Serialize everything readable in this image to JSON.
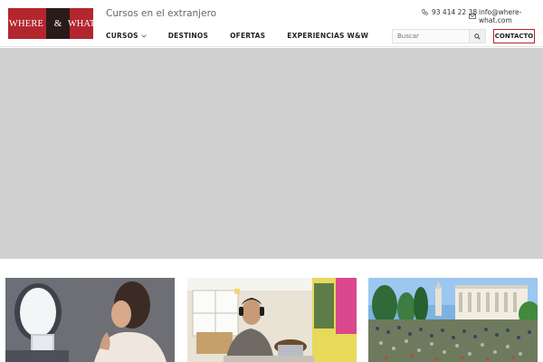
{
  "logo": {
    "left": "WHERE",
    "amp": "&",
    "right": "WHAT"
  },
  "header": {
    "tagline": "Cursos en el extranjero",
    "phone": "93 414 22 38",
    "email": "info@where-what.com"
  },
  "nav": {
    "items": [
      {
        "label": "CURSOS",
        "has_dropdown": true
      },
      {
        "label": "DESTINOS"
      },
      {
        "label": "OFERTAS"
      },
      {
        "label": "EXPERIENCIAS W&W"
      }
    ]
  },
  "search": {
    "placeholder": "Buscar"
  },
  "contact_button": {
    "label": "CONTACTO"
  },
  "colors": {
    "brand": "#b3262d",
    "accent": "#3aa07a",
    "hero_placeholder": "#d0d0d0"
  },
  "icons": [
    "phone-icon",
    "mail-icon",
    "search-icon",
    "chevron-down-icon"
  ],
  "cards": [
    {
      "image": "woman-on-airplane-photo"
    },
    {
      "image": "man-with-headphones-laptop-photo"
    },
    {
      "image": "university-campus-crowd-photo"
    }
  ]
}
